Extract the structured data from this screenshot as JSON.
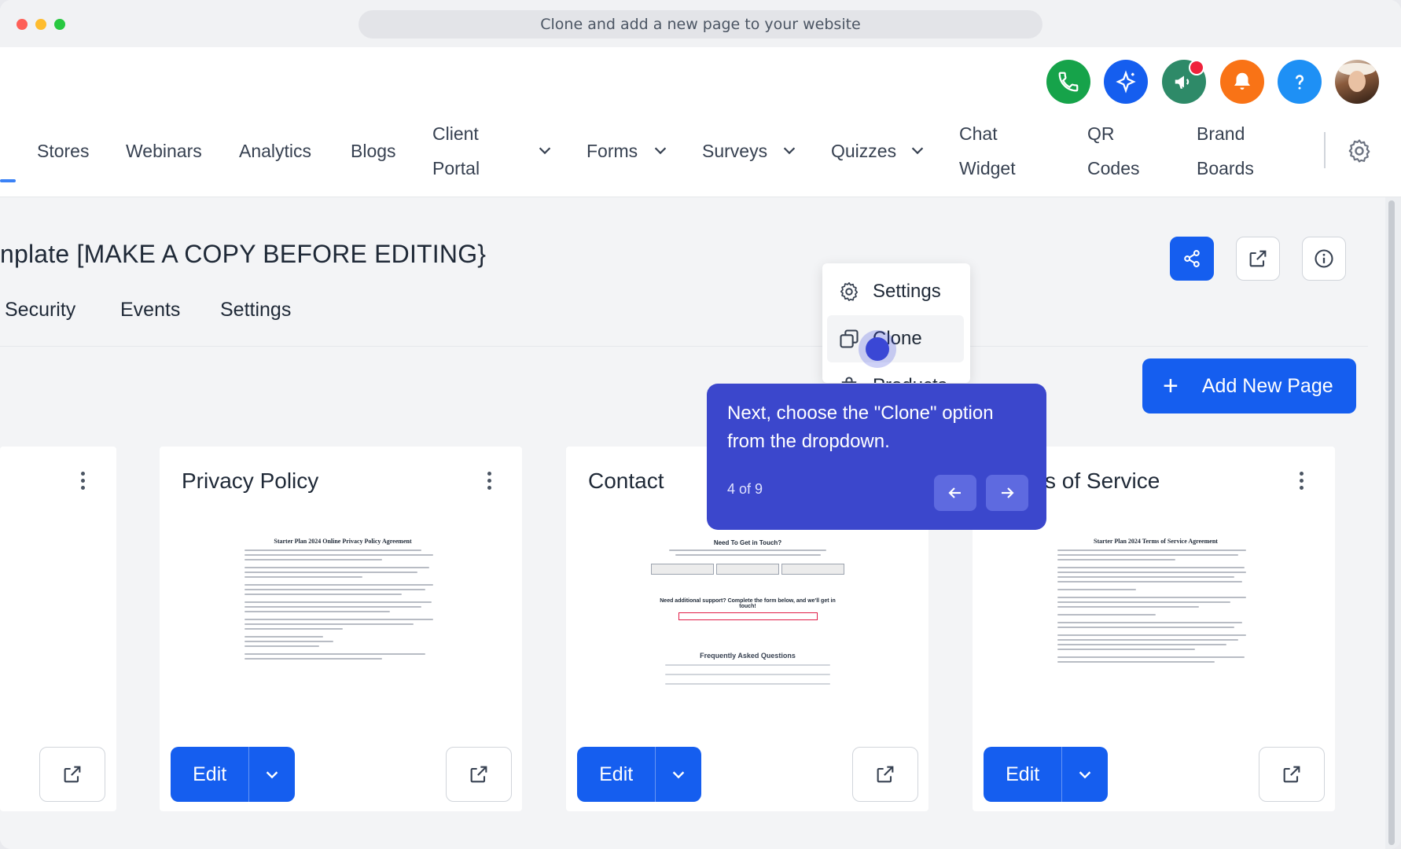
{
  "window": {
    "url_title": "Clone and add a new page to your website"
  },
  "header": {
    "icons": [
      "phone-icon",
      "sparkle-icon",
      "megaphone-icon",
      "bell-icon",
      "help-icon"
    ],
    "colors": {
      "phone": "#16a34a",
      "sparkle": "#155eef",
      "megaphone": "#2e8a68",
      "bell": "#f97316",
      "help": "#1e90f5"
    },
    "nav": {
      "stores": "Stores",
      "webinars": "Webinars",
      "analytics": "Analytics",
      "blogs": "Blogs",
      "client_portal_1": "Client",
      "client_portal_2": "Portal",
      "forms": "Forms",
      "surveys": "Surveys",
      "quizzes": "Quizzes",
      "chat_widget_1": "Chat",
      "chat_widget_2": "Widget",
      "qr_codes_1": "QR",
      "qr_codes_2": "Codes",
      "brand_boards_1": "Brand",
      "brand_boards_2": "Boards"
    }
  },
  "page": {
    "title": "nplate [MAKE A COPY BEFORE EDITING}",
    "tabs": {
      "security": "Security",
      "events": "Events",
      "settings": "Settings"
    },
    "add_new_page": "Add New Page"
  },
  "dropdown": {
    "items": {
      "settings": "Settings",
      "clone": "Clone",
      "products": "Products"
    }
  },
  "tooltip": {
    "text": "Next, choose the \"Clone\" option from the dropdown.",
    "step": "4 of 9"
  },
  "cards": {
    "privacy": {
      "title": "Privacy Policy",
      "thumb_heading": "Starter Plan 2024 Online Privacy Policy Agreement",
      "edit": "Edit"
    },
    "contact": {
      "title": "Contact",
      "thumb_heading": "Need To Get in Touch?",
      "thumb_sub": "Need additional support? Complete the form below, and we'll get in touch!",
      "thumb_faq": "Frequently Asked Questions",
      "edit": "Edit"
    },
    "terms": {
      "title": "s of Service",
      "thumb_heading": "Starter Plan 2024 Terms of Service Agreement",
      "edit": "Edit"
    }
  }
}
